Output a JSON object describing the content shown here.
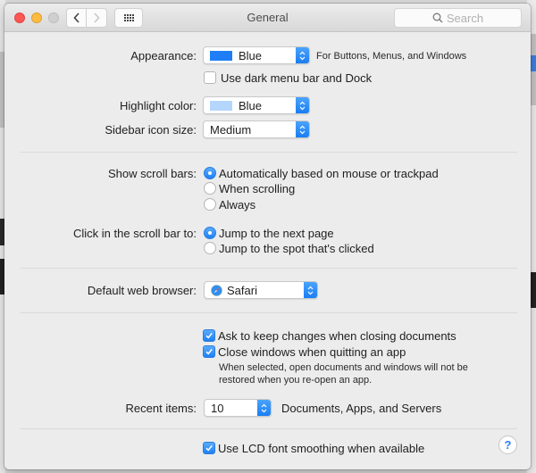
{
  "window": {
    "title": "General",
    "search_placeholder": "Search"
  },
  "appearance": {
    "label": "Appearance:",
    "value": "Blue",
    "swatch_color": "#1f7ef5",
    "note": "For Buttons, Menus, and Windows",
    "dark_menu": {
      "label": "Use dark menu bar and Dock",
      "checked": false
    }
  },
  "highlight": {
    "label": "Highlight color:",
    "value": "Blue",
    "swatch_color": "#b4d6fd"
  },
  "sidebar_icon_size": {
    "label": "Sidebar icon size:",
    "value": "Medium"
  },
  "scroll_bars": {
    "label": "Show scroll bars:",
    "options": [
      {
        "label": "Automatically based on mouse or trackpad",
        "selected": true
      },
      {
        "label": "When scrolling",
        "selected": false
      },
      {
        "label": "Always",
        "selected": false
      }
    ]
  },
  "click_scroll": {
    "label": "Click in the scroll bar to:",
    "options": [
      {
        "label": "Jump to the next page",
        "selected": true
      },
      {
        "label": "Jump to the spot that's clicked",
        "selected": false
      }
    ]
  },
  "browser": {
    "label": "Default web browser:",
    "value": "Safari",
    "icon": "safari-icon"
  },
  "documents": {
    "ask_keep": {
      "label": "Ask to keep changes when closing documents",
      "checked": true
    },
    "close_windows": {
      "label": "Close windows when quitting an app",
      "checked": true
    },
    "note": "When selected, open documents and windows will not be restored when you re-open an app."
  },
  "recent_items": {
    "label": "Recent items:",
    "value": "10",
    "suffix": "Documents, Apps, and Servers"
  },
  "lcd": {
    "label": "Use LCD font smoothing when available",
    "checked": true
  },
  "help": {
    "label": "?"
  },
  "colors": {
    "accent": "#1f80f4",
    "close": "#fc5753",
    "minimize": "#fdbc40",
    "zoom_disabled": "#cfcfcf"
  }
}
